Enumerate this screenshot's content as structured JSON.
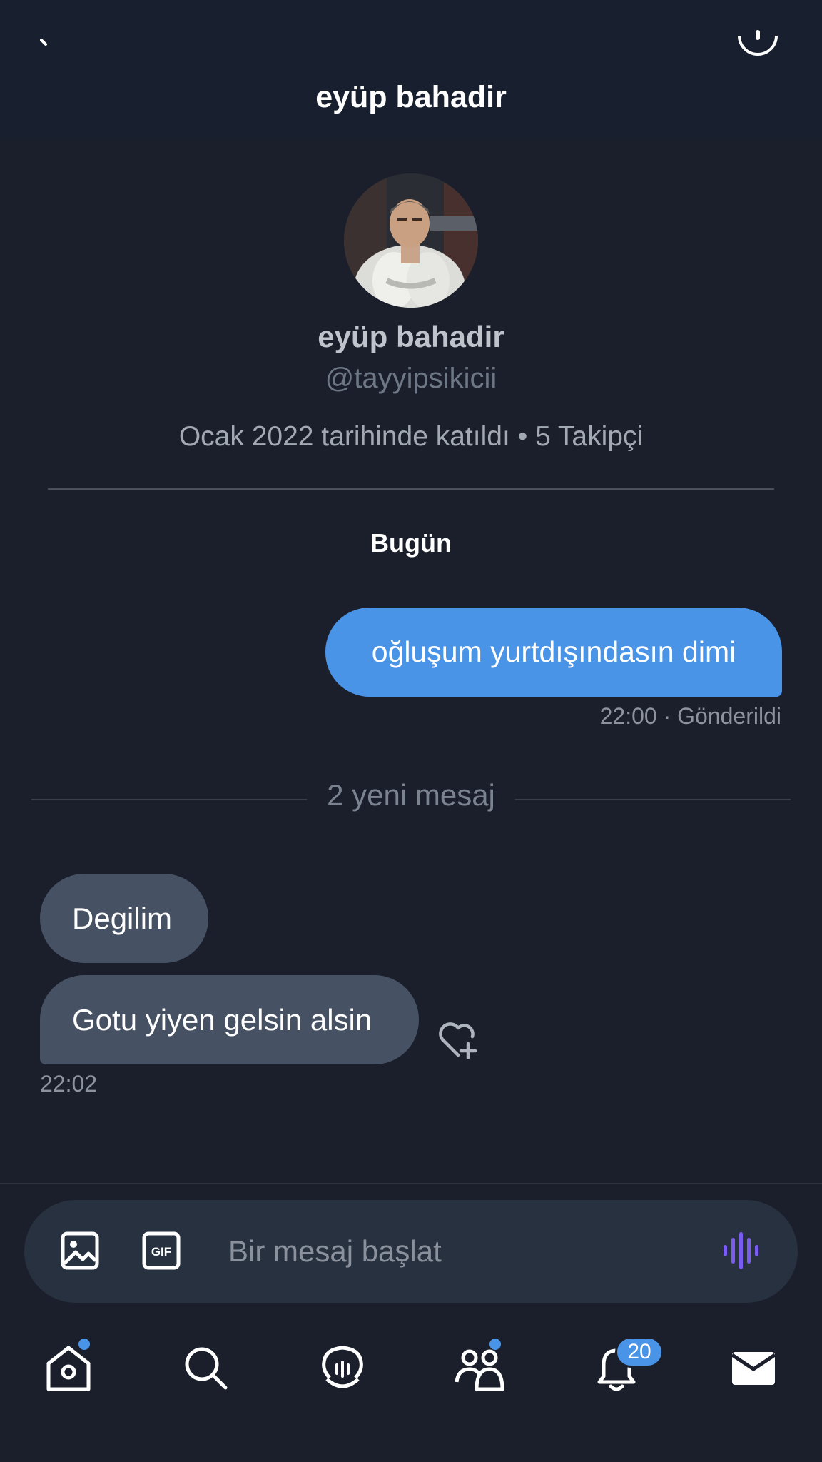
{
  "header": {
    "title": "eyüp bahadir"
  },
  "profile": {
    "name": "eyüp bahadir",
    "handle": "@tayyipsikicii",
    "meta": "Ocak 2022 tarihinde katıldı • 5 Takipçi"
  },
  "conversation": {
    "day_label": "Bugün",
    "sent": [
      {
        "text": "oğluşum yurtdışındasın dimi",
        "time": "22:00",
        "status": "· Gönderildi"
      }
    ],
    "new_messages_label": "2 yeni mesaj",
    "received": [
      {
        "text": "Degilim"
      },
      {
        "text": "Gotu yiyen gelsin alsin"
      }
    ],
    "received_time": "22:02"
  },
  "composer": {
    "placeholder": "Bir mesaj başlat",
    "gif_label": "GIF",
    "icons": [
      "image-icon",
      "gif-icon",
      "voice-icon"
    ]
  },
  "bottom_nav": {
    "items": [
      "home-icon",
      "search-icon",
      "spaces-icon",
      "communities-icon",
      "notifications-icon",
      "messages-icon"
    ],
    "notification_count": "20",
    "unread_dots": [
      "home",
      "communities"
    ]
  },
  "colors": {
    "background": "#1b1f2b",
    "accent": "#4a94e8",
    "received_bubble": "#465264",
    "voice": "#7b5cf0"
  }
}
